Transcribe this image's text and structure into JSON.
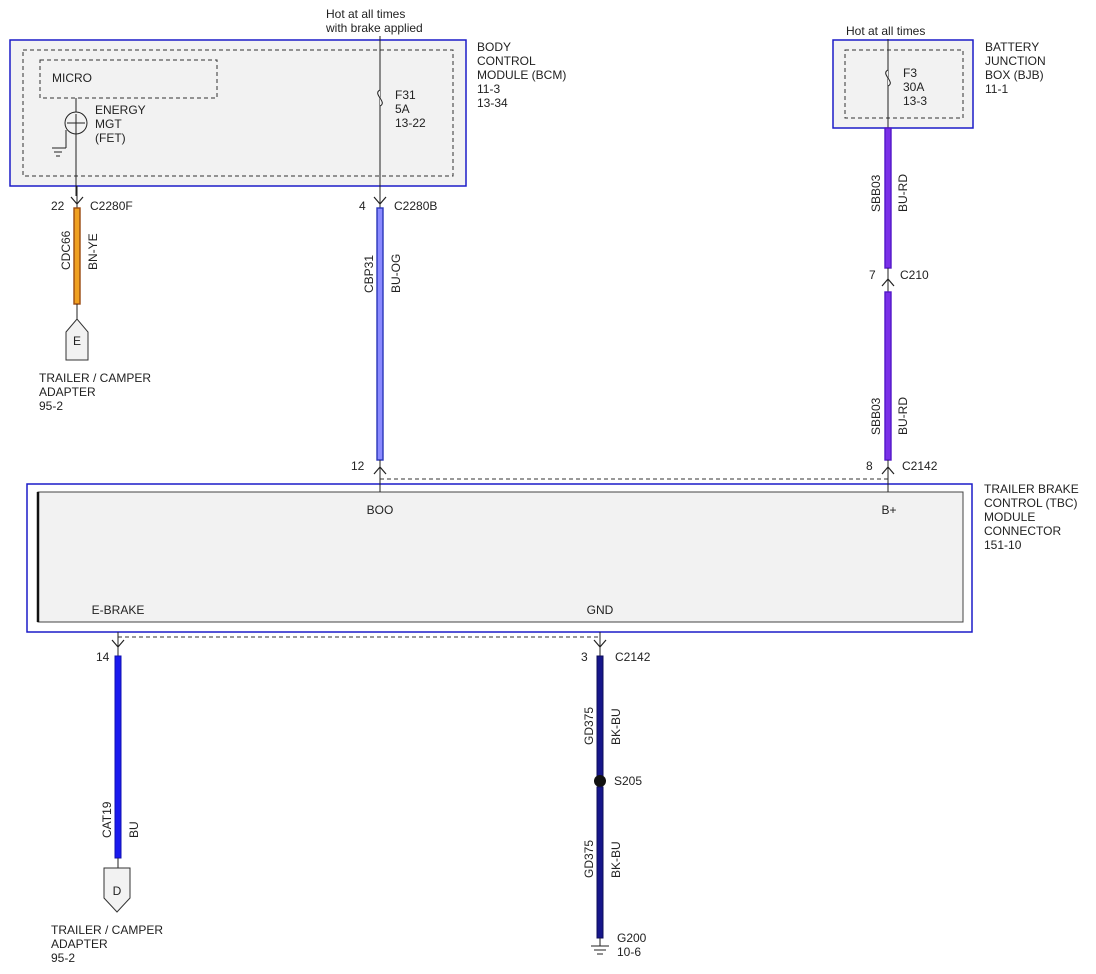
{
  "colors": {
    "module_border": "#1c1cc8",
    "module_fill": "#f2f2f2",
    "wire_bu": "#1a1aee",
    "wire_bu_rd": "#5218c8",
    "wire_bu_og": "#2a36b8",
    "wire_bn_ye": "#9a4a10",
    "wire_bk_bu": "#16168a"
  },
  "bcm": {
    "name_lines": [
      "BODY",
      "CONTROL",
      "MODULE (BCM)",
      "11-3",
      "13-34"
    ],
    "micro": "MICRO",
    "fet_lines": [
      "ENERGY",
      "MGT",
      "(FET)"
    ],
    "hot_lines": [
      "Hot at all times",
      "with brake applied"
    ],
    "fuse_lines": [
      "F31",
      "5A",
      "13-22"
    ]
  },
  "bjb": {
    "name_lines": [
      "BATTERY",
      "JUNCTION",
      "BOX (BJB)",
      "11-1"
    ],
    "hot": "Hot at all times",
    "fuse_lines": [
      "F3",
      "30A",
      "13-3"
    ]
  },
  "tbc": {
    "name_lines": [
      "TRAILER BRAKE",
      "CONTROL (TBC)",
      "MODULE",
      "CONNECTOR",
      "151-10"
    ],
    "pin_boo": "BOO",
    "pin_bplus": "B+",
    "pin_ebrake": "E-BRAKE",
    "pin_gnd": "GND"
  },
  "circuits": {
    "cdc66": {
      "pin": "22",
      "connector": "C2280F",
      "circuit": "CDC66",
      "color": "BN-YE"
    },
    "cbp31": {
      "pin": "4",
      "connector": "C2280B",
      "circuit": "CBP31",
      "color": "BU-OG",
      "pin_tbc": "12"
    },
    "sbb03_top": {
      "circuit": "SBB03",
      "color": "BU-RD"
    },
    "c210": {
      "pin": "7",
      "connector": "C210"
    },
    "sbb03_bottom": {
      "circuit": "SBB03",
      "color": "BU-RD",
      "pin_tbc": "8",
      "connector": "C2142"
    },
    "cat19": {
      "pin": "14",
      "circuit": "CAT19",
      "color": "BU"
    },
    "gd375_top": {
      "pin": "3",
      "connector": "C2142",
      "circuit": "GD375",
      "color": "BK-BU"
    },
    "splice": "S205",
    "gd375_bottom": {
      "circuit": "GD375",
      "color": "BK-BU"
    },
    "ground_lines": [
      "G200",
      "10-6"
    ]
  },
  "trailer_e": {
    "letter": "E",
    "lines": [
      "TRAILER / CAMPER",
      "ADAPTER",
      "95-2"
    ]
  },
  "trailer_d": {
    "letter": "D",
    "lines": [
      "TRAILER / CAMPER",
      "ADAPTER",
      "95-2"
    ]
  }
}
